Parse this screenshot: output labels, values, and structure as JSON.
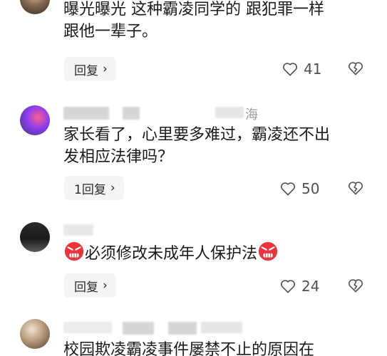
{
  "comments": [
    {
      "text": [
        "曝光曝光 这种霸凌同学的 跟犯罪一样",
        "跟他一辈子。"
      ],
      "reply_label": "回复",
      "like_count": "41",
      "icons": [
        "heart-icon",
        "broken-heart-icon",
        "chevron-right-icon"
      ]
    },
    {
      "username_visible": "海",
      "text": [
        "家长看了，心里要多难过，霸凌还不出",
        "发相应法律吗？"
      ],
      "reply_label": "1回复",
      "like_count": "50",
      "icons": [
        "heart-icon",
        "broken-heart-icon",
        "chevron-right-icon"
      ]
    },
    {
      "text": [
        "必须修改未成年人保护法"
      ],
      "reply_label": "回复",
      "like_count": "24",
      "icons": [
        "angry-face-icon",
        "heart-icon",
        "broken-heart-icon",
        "chevron-right-icon"
      ]
    },
    {
      "text": [
        "校园欺凌霸凌事件屡禁不止的原因在"
      ]
    }
  ],
  "colors": {
    "text": "#1a1a1a",
    "muted": "#505050",
    "button_bg": "#f5f5f5",
    "icon_stroke": "#555555",
    "emoji_red": "#e8353b"
  }
}
